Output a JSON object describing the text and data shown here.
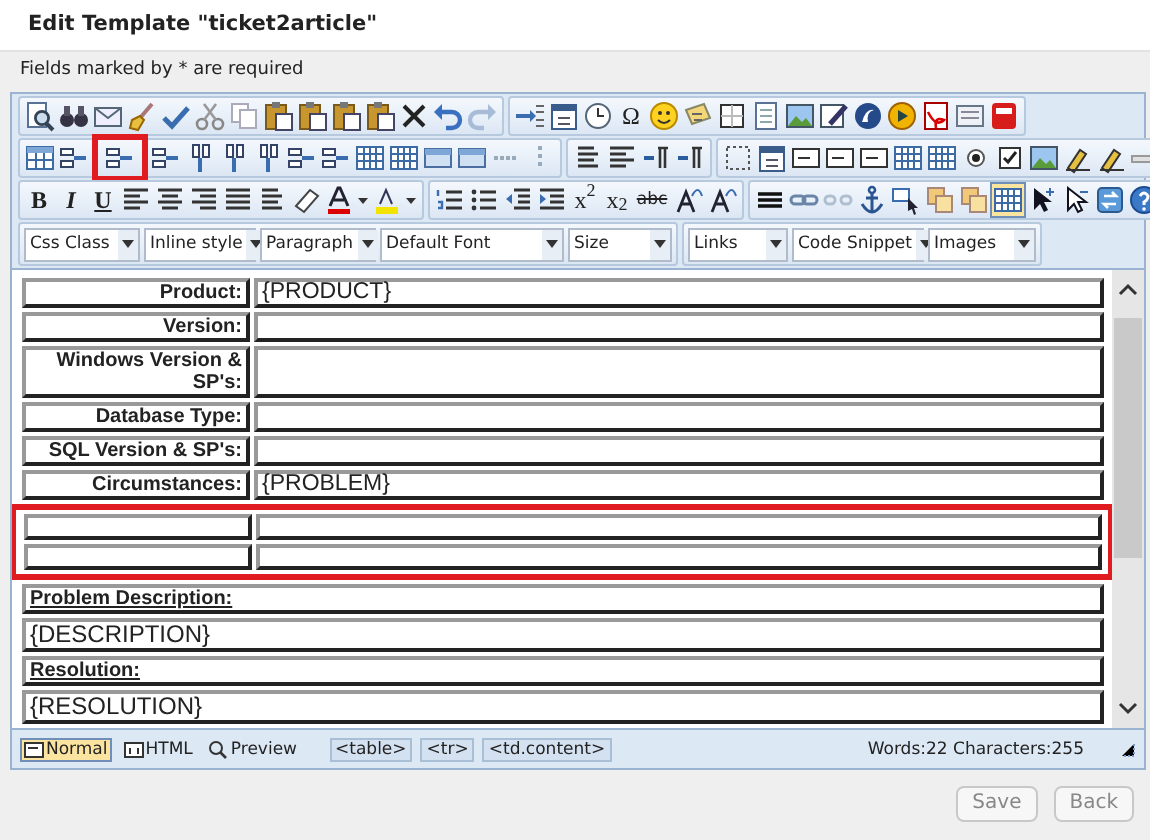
{
  "dialog": {
    "title": "Edit Template \"ticket2article\"",
    "notice": "Fields marked by * are required"
  },
  "toolbar": {
    "glyphs": [
      {
        "kind": "bold",
        "text": "B"
      },
      {
        "kind": "italic",
        "text": "I"
      },
      {
        "kind": "underline",
        "text": "U"
      },
      {
        "kind": "plain",
        "text": "Ω"
      },
      {
        "kind": "plain",
        "text": "x$^{2}$"
      },
      {
        "kind": "plain",
        "text": "x$_{2}$"
      },
      {
        "kind": "strike",
        "text": "abc"
      }
    ],
    "show_borders": {
      "selected": true
    },
    "insert_row_after": {
      "highlighted": true
    },
    "dropdowns": [
      {
        "label": "Css Class"
      },
      {
        "label": "Inline style"
      },
      {
        "label": "Paragraph"
      },
      {
        "label": "Default Font"
      },
      {
        "label": "Size"
      },
      {
        "label": "Links"
      },
      {
        "label": "Code Snippet"
      },
      {
        "label": "Images"
      }
    ]
  },
  "table": {
    "rows": [
      {
        "kind": "pair",
        "label": "Product:",
        "value": "{PRODUCT}"
      },
      {
        "kind": "pair",
        "label": "Version:",
        "value": ""
      },
      {
        "kind": "pair",
        "label": "Windows Version & SP's:",
        "value": ""
      },
      {
        "kind": "pair",
        "label": "Database Type:",
        "value": ""
      },
      {
        "kind": "pair",
        "label": "SQL Version & SP's:",
        "value": ""
      },
      {
        "kind": "pair",
        "label": "Circumstances:",
        "value": "{PROBLEM}"
      }
    ],
    "highlighted_rows": [
      {
        "kind": "pair",
        "label": "",
        "value": ""
      },
      {
        "kind": "pair",
        "label": "",
        "value": ""
      }
    ],
    "rows_after": [
      {
        "kind": "heading",
        "text": "Problem Description:"
      },
      {
        "kind": "text",
        "text": "{DESCRIPTION}"
      },
      {
        "kind": "heading",
        "text": "Resolution:"
      },
      {
        "kind": "text",
        "text": "{RESOLUTION}"
      }
    ]
  },
  "status_bar": {
    "modes": [
      {
        "kind": "normal",
        "label": "Normal",
        "selected": true
      },
      {
        "kind": "html",
        "label": "HTML",
        "selected": false
      },
      {
        "kind": "preview",
        "label": "Preview",
        "selected": false
      }
    ],
    "breadcrumbs": [
      "<table>",
      "<tr>",
      "<td.content>"
    ],
    "counts": "Words:22 Characters:255"
  },
  "buttons": [
    {
      "label": "Save"
    },
    {
      "label": "Back"
    }
  ]
}
